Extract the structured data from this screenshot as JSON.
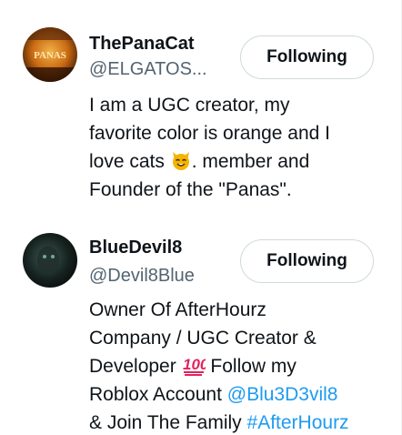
{
  "users": [
    {
      "name": "ThePanaCat",
      "handle": "@ELGATOS...",
      "follow_label": "Following",
      "avatar_text": "PANAS",
      "bio": {
        "line1": "I am a UGC creator, my",
        "line2": "favorite color is orange and I",
        "line3_a": "love cats",
        "line3_b": ". member and",
        "line4": "Founder of the \"Panas\"."
      }
    },
    {
      "name": "BlueDevil8",
      "handle": "@Devil8Blue",
      "follow_label": "Following",
      "bio": {
        "line1": "Owner Of AfterHourz",
        "line2": "Company / UGC Creator &",
        "line3_a": "Developer",
        "line3_b": " Follow my",
        "line4_a": "Roblox Account ",
        "line4_mention": "@Blu3D3vil8",
        "line5_a": "& Join The Family ",
        "line5_hashtag": "#AfterHourz"
      }
    }
  ],
  "colors": {
    "text": "#0f1419",
    "secondary": "#536471",
    "link": "#1d9bf0",
    "button_border": "#cfd9de"
  },
  "icons": [
    "cat-face-emoji-icon",
    "hundred-points-emoji-icon"
  ]
}
